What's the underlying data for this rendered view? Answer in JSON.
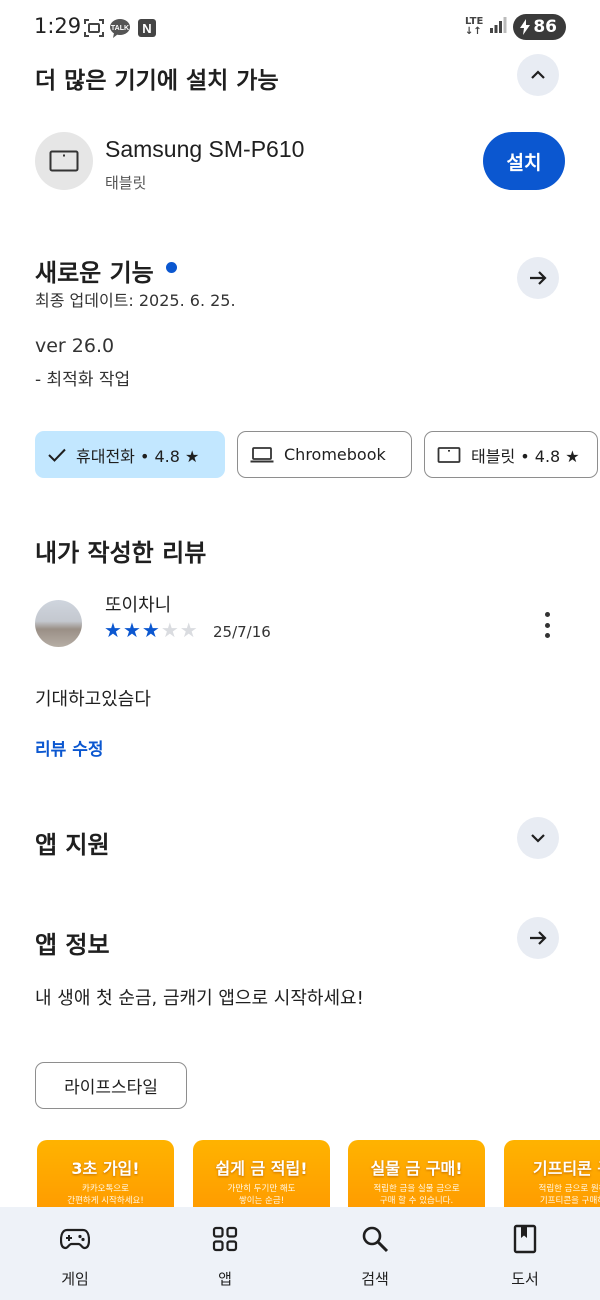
{
  "status_bar": {
    "time": "1:29",
    "network": "LTE",
    "battery": "86",
    "notification_icons": [
      "screenshot-icon",
      "kakaotalk-icon",
      "naver-icon"
    ],
    "kakao_label": "TALK",
    "naver_label": "N"
  },
  "devices_section": {
    "title": "더 많은 기기에 설치 가능",
    "device_name": "Samsung SM-P610",
    "device_type": "태블릿",
    "install_label": "설치"
  },
  "whats_new": {
    "title": "새로운 기능",
    "updated": "최종 업데이트: 2025. 6. 25.",
    "version": "ver 26.0",
    "notes": "- 최적화 작업"
  },
  "rating_chips": [
    {
      "label": "휴대전화 • 4.8 ★",
      "selected": true
    },
    {
      "label": "Chromebook",
      "selected": false
    },
    {
      "label": "태블릿 • 4.8 ★",
      "selected": false
    }
  ],
  "my_review": {
    "title": "내가 작성한 리뷰",
    "reviewer": "또이차니",
    "rating": 3,
    "max_rating": 5,
    "date": "25/7/16",
    "text": "기대하고있슴다",
    "edit_label": "리뷰 수정"
  },
  "app_support": {
    "title": "앱 지원"
  },
  "app_info": {
    "title": "앱 정보",
    "description": "내 생애 첫 순금, 금캐기 앱으로 시작하세요!",
    "category": "라이프스타일"
  },
  "screenshots": [
    {
      "title": "3초 가입!",
      "line1": "카카오톡으로",
      "line2": "간편하게 시작하세요!"
    },
    {
      "title": "쉽게 금 적립!",
      "line1": "가만히 두기만 해도",
      "line2": "쌓이는 순금!"
    },
    {
      "title": "실물 금 구매!",
      "line1": "적립한 금을 실물 금으로",
      "line2": "구매 할 수 있습니다."
    },
    {
      "title": "기프티콘 구",
      "line1": "적립한 금으로 원하",
      "line2": "기프티콘을 구매하"
    }
  ],
  "bottom_nav": [
    {
      "label": "게임",
      "icon": "gamepad-icon"
    },
    {
      "label": "앱",
      "icon": "apps-grid-icon"
    },
    {
      "label": "검색",
      "icon": "search-icon"
    },
    {
      "label": "도서",
      "icon": "book-icon"
    }
  ],
  "colors": {
    "accent": "#0b57d0",
    "chip_selected": "#c2e7ff",
    "round_button": "#e8ecf3",
    "nav_background": "#eef2f8",
    "screenshot_orange": "#ffa000"
  }
}
